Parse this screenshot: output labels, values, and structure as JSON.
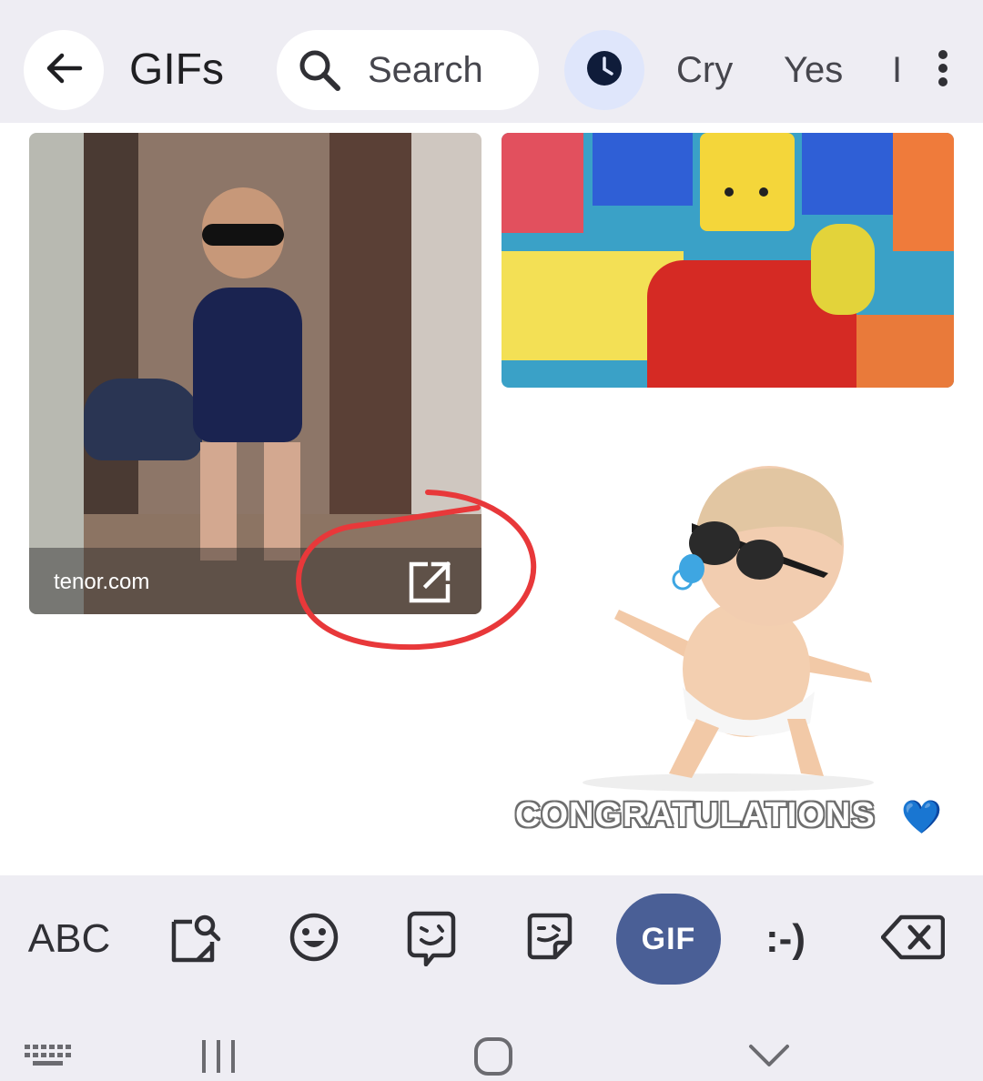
{
  "header": {
    "title": "GIFs",
    "search_placeholder": "Search",
    "chips": [
      "Cry",
      "Yes",
      "I"
    ]
  },
  "icons": {
    "back": "arrow-left-icon",
    "search": "search-icon",
    "recent": "clock-icon",
    "more": "more-vert-icon",
    "open_external": "open-in-new-icon",
    "sticker_search": "sticker-search-icon",
    "emoji": "emoji-icon",
    "bitmoji": "bitmoji-icon",
    "sticker": "sticker-icon",
    "backspace": "backspace-icon",
    "keyboard_switch": "keyboard-icon",
    "recents": "recents-nav-icon",
    "home": "home-nav-icon",
    "hide_keyboard": "chevron-down-icon"
  },
  "gifs": [
    {
      "source": "tenor.com"
    },
    {},
    {
      "caption": "CONGRATULATIONS",
      "emoji": "💙"
    }
  ],
  "keyboard_toolbar": {
    "abc_label": "ABC",
    "gif_label": "GIF",
    "emoticon_label": ":-)"
  },
  "colors": {
    "toolbar_bg": "#eeedf3",
    "recent_active_bg": "#dfe6fb",
    "gif_active_bg": "#4a5f96",
    "annotation_red": "#e8383a"
  }
}
